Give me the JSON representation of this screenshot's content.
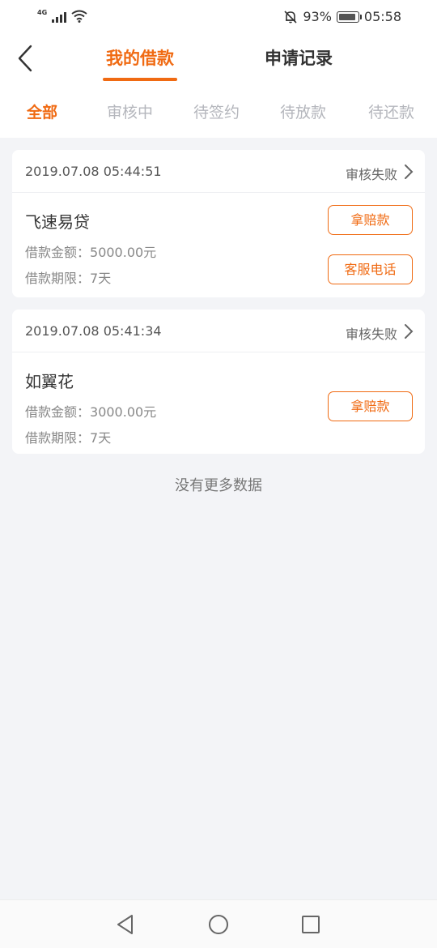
{
  "status_bar": {
    "network": "4G",
    "battery_percent": "93%",
    "time": "05:58",
    "icons": [
      "signal-icon",
      "wifi-icon",
      "bell-muted-icon",
      "battery-icon"
    ]
  },
  "header": {
    "back_icon": "chevron-left-icon",
    "tabs": [
      {
        "label": "我的借款",
        "active": true
      },
      {
        "label": "申请记录",
        "active": false
      }
    ]
  },
  "sub_tabs": [
    {
      "label": "全部",
      "active": true
    },
    {
      "label": "审核中",
      "active": false
    },
    {
      "label": "待签约",
      "active": false
    },
    {
      "label": "待放款",
      "active": false
    },
    {
      "label": "待还款",
      "active": false
    }
  ],
  "loans": [
    {
      "time": "2019.07.08 05:44:51",
      "status": "审核失败",
      "name": "飞速易贷",
      "amount_label": "借款金额：",
      "amount": "5000.00元",
      "term_label": "借款期限：",
      "term": "7天",
      "buttons": [
        "拿赔款",
        "客服电话"
      ]
    },
    {
      "time": "2019.07.08 05:41:34",
      "status": "审核失败",
      "name": "如翼花",
      "amount_label": "借款金额：",
      "amount": "3000.00元",
      "term_label": "借款期限：",
      "term": "7天",
      "buttons": [
        "拿赔款"
      ]
    }
  ],
  "footer_text": "没有更多数据",
  "colors": {
    "accent": "#f06a12",
    "background": "#f3f4f7",
    "inactive_tab": "#b4b6bc"
  }
}
